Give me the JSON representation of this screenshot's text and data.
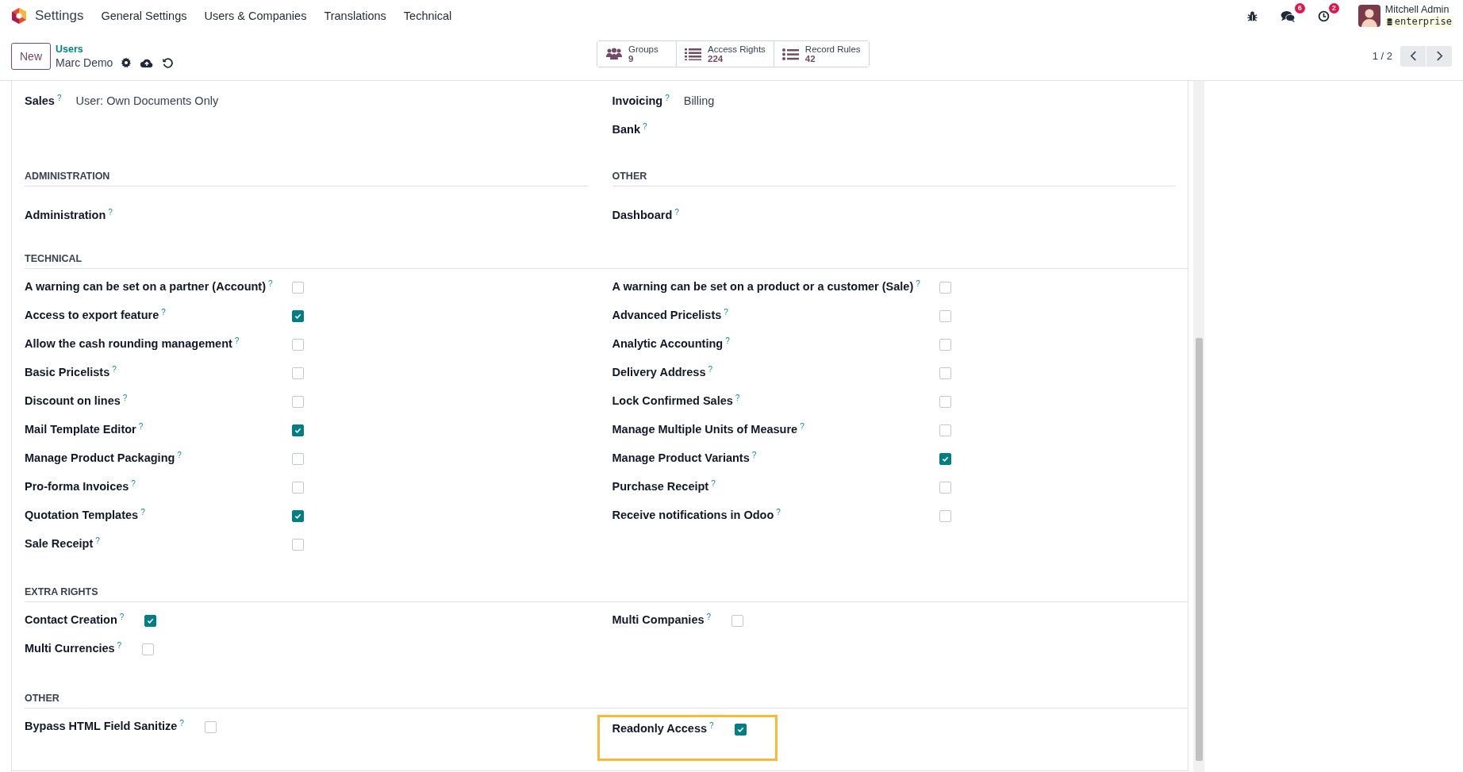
{
  "navbar": {
    "app_name": "Settings",
    "menu": [
      "General Settings",
      "Users & Companies",
      "Translations",
      "Technical"
    ],
    "systray": [
      {
        "kind": "bug"
      },
      {
        "kind": "chat",
        "badge": "6"
      },
      {
        "kind": "clock",
        "badge": "2"
      }
    ],
    "user": {
      "name": "Mitchell Admin",
      "database": "enterprise"
    }
  },
  "control_panel": {
    "new_button": "New",
    "breadcrumb": "Users",
    "record_name": "Marc Demo",
    "smart_buttons": [
      {
        "kind": "groups",
        "label": "Groups",
        "count": "9"
      },
      {
        "kind": "list",
        "label": "Access Rights",
        "count": "224"
      },
      {
        "kind": "dots",
        "label": "Record Rules",
        "count": "42"
      }
    ],
    "pager": "1 / 2"
  },
  "sections": [
    {
      "kind": "aligned",
      "columns": [
        {
          "fields": [
            {
              "kind": "selection",
              "label": "Sales",
              "help": "?",
              "value": "User: Own Documents Only"
            }
          ]
        },
        {
          "fields": [
            {
              "kind": "selection",
              "label": "Invoicing",
              "help": "?",
              "value": "Billing"
            },
            {
              "kind": "selection",
              "label": "Bank",
              "help": "?"
            }
          ]
        }
      ]
    },
    {
      "kind": "aligned",
      "columns": [
        {
          "title": "ADMINISTRATION",
          "fields": [
            {
              "kind": "selection",
              "label": "Administration",
              "help": "?"
            }
          ]
        },
        {
          "title": "OTHER",
          "fields": [
            {
              "kind": "selection",
              "label": "Dashboard",
              "help": "?"
            }
          ]
        }
      ]
    },
    {
      "title": "TECHNICAL",
      "kind": "aligned",
      "columns": [
        {
          "fields": [
            {
              "kind": "checkbox",
              "label": "A warning can be set on a partner (Account)",
              "help": "?",
              "checked": false
            },
            {
              "kind": "checkbox",
              "label": "Access to export feature",
              "help": "?",
              "checked": true
            },
            {
              "kind": "checkbox",
              "label": "Allow the cash rounding management",
              "help": "?",
              "checked": false
            },
            {
              "kind": "checkbox",
              "label": "Basic Pricelists",
              "help": "?",
              "checked": false
            },
            {
              "kind": "checkbox",
              "label": "Discount on lines",
              "help": "?",
              "checked": false
            },
            {
              "kind": "checkbox",
              "label": "Mail Template Editor",
              "help": "?",
              "checked": true
            },
            {
              "kind": "checkbox",
              "label": "Manage Product Packaging",
              "help": "?",
              "checked": false
            },
            {
              "kind": "checkbox",
              "label": "Pro-forma Invoices",
              "help": "?",
              "checked": false
            },
            {
              "kind": "checkbox",
              "label": "Quotation Templates",
              "help": "?",
              "checked": true
            },
            {
              "kind": "checkbox",
              "label": "Sale Receipt",
              "help": "?",
              "checked": false
            }
          ]
        },
        {
          "fields": [
            {
              "kind": "checkbox",
              "label": "A warning can be set on a product or a customer (Sale)",
              "help": "?",
              "checked": false
            },
            {
              "kind": "checkbox",
              "label": "Advanced Pricelists",
              "help": "?",
              "checked": false
            },
            {
              "kind": "checkbox",
              "label": "Analytic Accounting",
              "help": "?",
              "checked": false
            },
            {
              "kind": "checkbox",
              "label": "Delivery Address",
              "help": "?",
              "checked": false
            },
            {
              "kind": "checkbox",
              "label": "Lock Confirmed Sales",
              "help": "?",
              "checked": false
            },
            {
              "kind": "checkbox",
              "label": "Manage Multiple Units of Measure",
              "help": "?",
              "checked": false
            },
            {
              "kind": "checkbox",
              "label": "Manage Product Variants",
              "help": "?",
              "checked": true
            },
            {
              "kind": "checkbox",
              "label": "Purchase Receipt",
              "help": "?",
              "checked": false
            },
            {
              "kind": "checkbox",
              "label": "Receive notifications in Odoo",
              "help": "?",
              "checked": false
            }
          ]
        }
      ]
    },
    {
      "title": "EXTRA RIGHTS",
      "kind": "inline",
      "columns": [
        {
          "fields": [
            {
              "kind": "checkbox",
              "label": "Contact Creation",
              "help": "?",
              "checked": true
            },
            {
              "kind": "checkbox",
              "label": "Multi Currencies",
              "help": "?",
              "checked": false
            }
          ]
        },
        {
          "fields": [
            {
              "kind": "checkbox",
              "label": "Multi Companies",
              "help": "?",
              "checked": false
            }
          ]
        }
      ]
    },
    {
      "title": "OTHER",
      "kind": "inline",
      "columns": [
        {
          "fields": [
            {
              "kind": "checkbox",
              "label": "Bypass HTML Field Sanitize",
              "help": "?",
              "checked": false
            }
          ]
        },
        {
          "fields": [
            {
              "kind": "checkbox",
              "label": "Readonly Access",
              "help": "?",
              "checked": true,
              "highlighted": true
            }
          ]
        }
      ]
    }
  ]
}
